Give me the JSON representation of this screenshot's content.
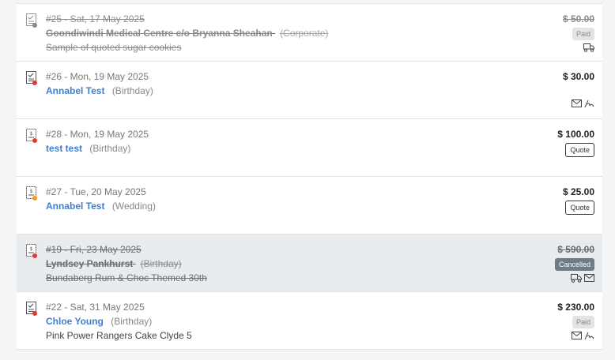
{
  "orders": [
    {
      "meta": "#25 - Sat, 17 May 2025",
      "customer": "Goondiwindi Medical Centre c/o Bryanna Sheahan",
      "occasion": "(Corporate)",
      "description": "Sample of quoted sugar cookies",
      "amount": "$ 50.00",
      "badge": "Paid",
      "status_dot": "#888888",
      "icons": [
        "delivery-truck-icon"
      ]
    },
    {
      "meta": "#26 - Mon, 19 May 2025",
      "customer": "Annabel Test",
      "occasion": "(Birthday)",
      "description": "",
      "amount": "$ 30.00",
      "badge": "",
      "status_dot": "#e53935",
      "icons": [
        "envelope-icon",
        "signature-icon"
      ]
    },
    {
      "meta": "#28 - Mon, 19 May 2025",
      "customer": "test test",
      "occasion": "(Birthday)",
      "description": "",
      "amount": "$ 100.00",
      "badge": "Quote",
      "status_dot": "#e53935",
      "icons": []
    },
    {
      "meta": "#27 - Tue, 20 May 2025",
      "customer": "Annabel Test",
      "occasion": "(Wedding)",
      "description": "",
      "amount": "$ 25.00",
      "badge": "Quote",
      "status_dot": "#f39c12",
      "icons": []
    },
    {
      "meta": "#19 - Fri, 23 May 2025",
      "customer": "Lyndsey Pankhurst",
      "occasion": "(Birthday)",
      "description": "Bundaberg Rum & Choc Themed 30th",
      "amount": "$ 590.00",
      "badge": "Cancelled",
      "status_dot": "#e53935",
      "icons": [
        "delivery-truck-icon",
        "envelope-icon"
      ]
    },
    {
      "meta": "#22 - Sat, 31 May 2025",
      "customer": "Chloe Young",
      "occasion": "(Birthday)",
      "description": "Pink Power Rangers Cake Clyde 5",
      "amount": "$ 230.00",
      "badge": "Paid",
      "status_dot": "#e53935",
      "icons": [
        "envelope-icon",
        "signature-icon"
      ]
    }
  ]
}
